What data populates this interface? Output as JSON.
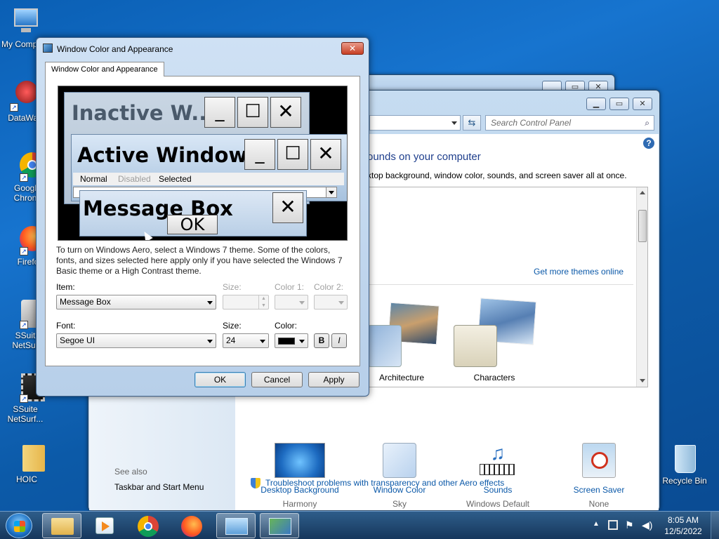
{
  "desktop": {
    "icons": [
      {
        "label": "My Comp"
      },
      {
        "label": "DataWag"
      },
      {
        "label": "Googl Chron"
      },
      {
        "label": "Firefo"
      },
      {
        "label": "SSuit NetSur"
      },
      {
        "label": "SSuite NetSurf..."
      },
      {
        "label": "HOIC"
      },
      {
        "label": "Recycle Bin"
      }
    ]
  },
  "control_panel": {
    "search_placeholder": "Search Control Panel",
    "heading": "ounds on your computer",
    "subheading": "ktop background, window color, sounds, and screen saver all at once.",
    "get_more_themes": "Get more themes online",
    "themes": [
      {
        "label": "Architecture"
      },
      {
        "label": "Characters"
      }
    ],
    "bottom_items": [
      {
        "label": "Desktop Background",
        "value": "Harmony"
      },
      {
        "label": "Window Color",
        "value": "Sky"
      },
      {
        "label": "Sounds",
        "value": "Windows Default"
      },
      {
        "label": "Screen Saver",
        "value": "None"
      }
    ],
    "see_also": "See also",
    "taskbar_link": "Taskbar and Start Menu",
    "troubleshoot": "Troubleshoot problems with transparency and other Aero effects"
  },
  "dialog": {
    "title": "Window Color and Appearance",
    "tab": "Window Color and Appearance",
    "preview": {
      "inactive_title": "Inactive W...",
      "active_title": "Active Window",
      "menu": [
        "Normal",
        "Disabled",
        "Selected"
      ],
      "message_title": "Message Box",
      "ok": "OK"
    },
    "description": "To turn on Windows Aero, select a Windows 7 theme.  Some of the colors, fonts, and sizes selected here apply only if you have selected the Windows 7 Basic theme or a High Contrast theme.",
    "item_label": "Item:",
    "item_value": "Message Box",
    "size1_label": "Size:",
    "color1_label": "Color 1:",
    "color2_label": "Color 2:",
    "font_label": "Font:",
    "font_value": "Segoe UI",
    "size2_label": "Size:",
    "size2_value": "24",
    "color_label": "Color:",
    "font_color": "#000000",
    "bold": "B",
    "italic": "I",
    "ok": "OK",
    "cancel": "Cancel",
    "apply": "Apply"
  },
  "taskbar": {
    "time": "8:05 AM",
    "date": "12/5/2022"
  }
}
